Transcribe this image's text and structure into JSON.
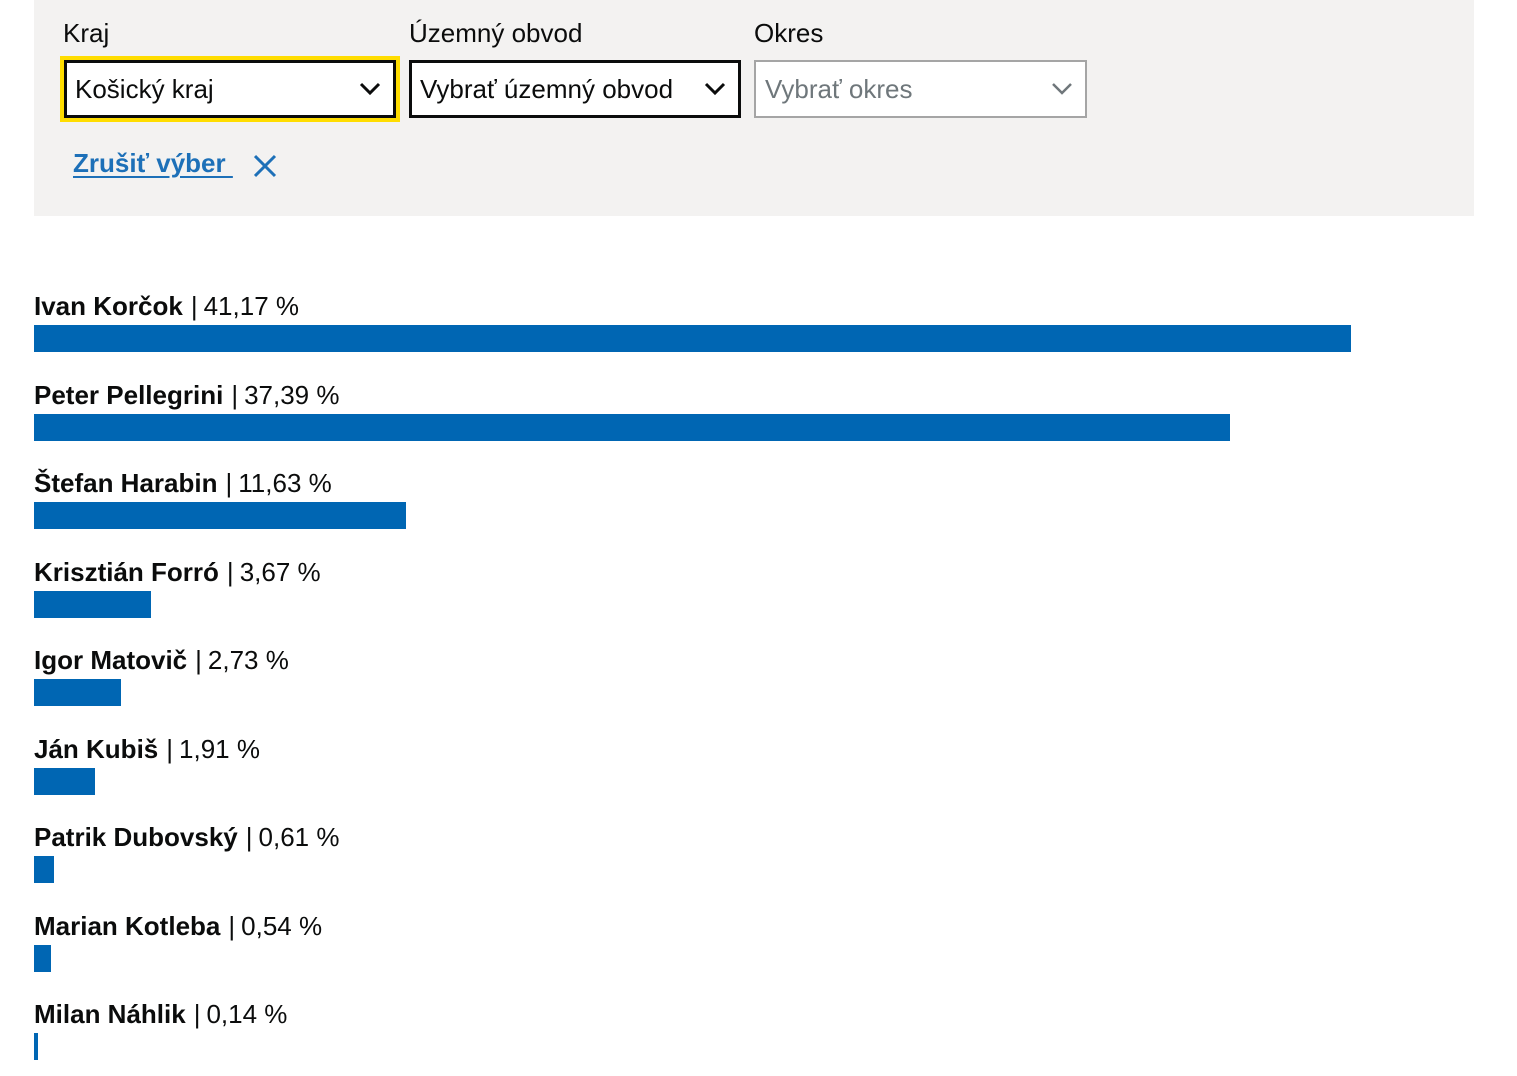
{
  "filters": {
    "region": {
      "label": "Kraj",
      "value": "Košický kraj"
    },
    "district": {
      "label": "Územný obvod",
      "placeholder": "Vybrať územný obvod"
    },
    "county": {
      "label": "Okres",
      "placeholder": "Vybrať okres"
    },
    "clear_label": "Zrušiť výber "
  },
  "icons": {
    "dropdown": "chevron-down-icon",
    "clear": "close-icon"
  },
  "colors": {
    "bar": "#0066b3",
    "panel": "#f3f2f1",
    "focus": "#ffdd00",
    "link": "#1d70b8"
  },
  "chart_data": {
    "type": "bar",
    "orientation": "horizontal",
    "xlim": [
      0,
      45
    ],
    "categories": [
      "Ivan Korčok",
      "Peter Pellegrini",
      "Štefan Harabin",
      "Krisztián Forró",
      "Igor Matovič",
      "Ján Kubiš",
      "Patrik Dubovský",
      "Marian Kotleba",
      "Milan Náhlik"
    ],
    "values": [
      41.17,
      37.39,
      11.63,
      3.67,
      2.73,
      1.91,
      0.61,
      0.54,
      0.14
    ],
    "value_labels": [
      "41,17 %",
      "37,39 %",
      "11,63 %",
      "3,67 %",
      "2,73 %",
      "1,91 %",
      "0,61 %",
      "0,54 %",
      "0,14 %"
    ]
  }
}
